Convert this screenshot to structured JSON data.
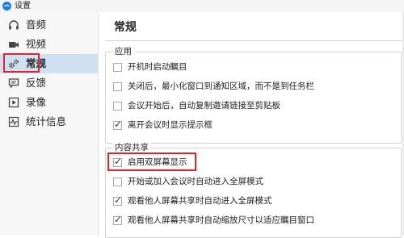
{
  "window": {
    "title": "设置"
  },
  "sidebar": {
    "items": [
      {
        "label": "音频",
        "icon": "headphones-icon"
      },
      {
        "label": "视频",
        "icon": "video-camera-icon"
      },
      {
        "label": "常规",
        "icon": "gears-icon",
        "active": true
      },
      {
        "label": "反馈",
        "icon": "feedback-icon"
      },
      {
        "label": "录像",
        "icon": "recording-icon"
      },
      {
        "label": "统计信息",
        "icon": "statistics-icon"
      }
    ]
  },
  "main": {
    "title": "常规",
    "groups": [
      {
        "legend": "应用",
        "options": [
          {
            "label": "开机时启动瞩目",
            "checked": false
          },
          {
            "label": "关闭后，最小化窗口到通知区域，而不是到任务栏",
            "checked": false
          },
          {
            "label": "会议开始后，自动复制邀请链接至剪贴板",
            "checked": false
          },
          {
            "label": "离开会议时显示提示框",
            "checked": true
          }
        ]
      },
      {
        "legend": "内容共享",
        "options": [
          {
            "label": "启用双屏幕显示",
            "checked": true
          },
          {
            "label": "开始或加入会议时自动进入全屏模式",
            "checked": false
          },
          {
            "label": "观看他人屏幕共享时自动进入全屏模式",
            "checked": true
          },
          {
            "label": "观看他人屏幕共享时自动缩放尺寸以适应瞩目窗口",
            "checked": true
          }
        ]
      }
    ]
  },
  "colors": {
    "active_bg": "#cfe0f3",
    "highlight": "#e3232c",
    "brand": "#1a7ee6"
  },
  "check_glyph": "✓"
}
